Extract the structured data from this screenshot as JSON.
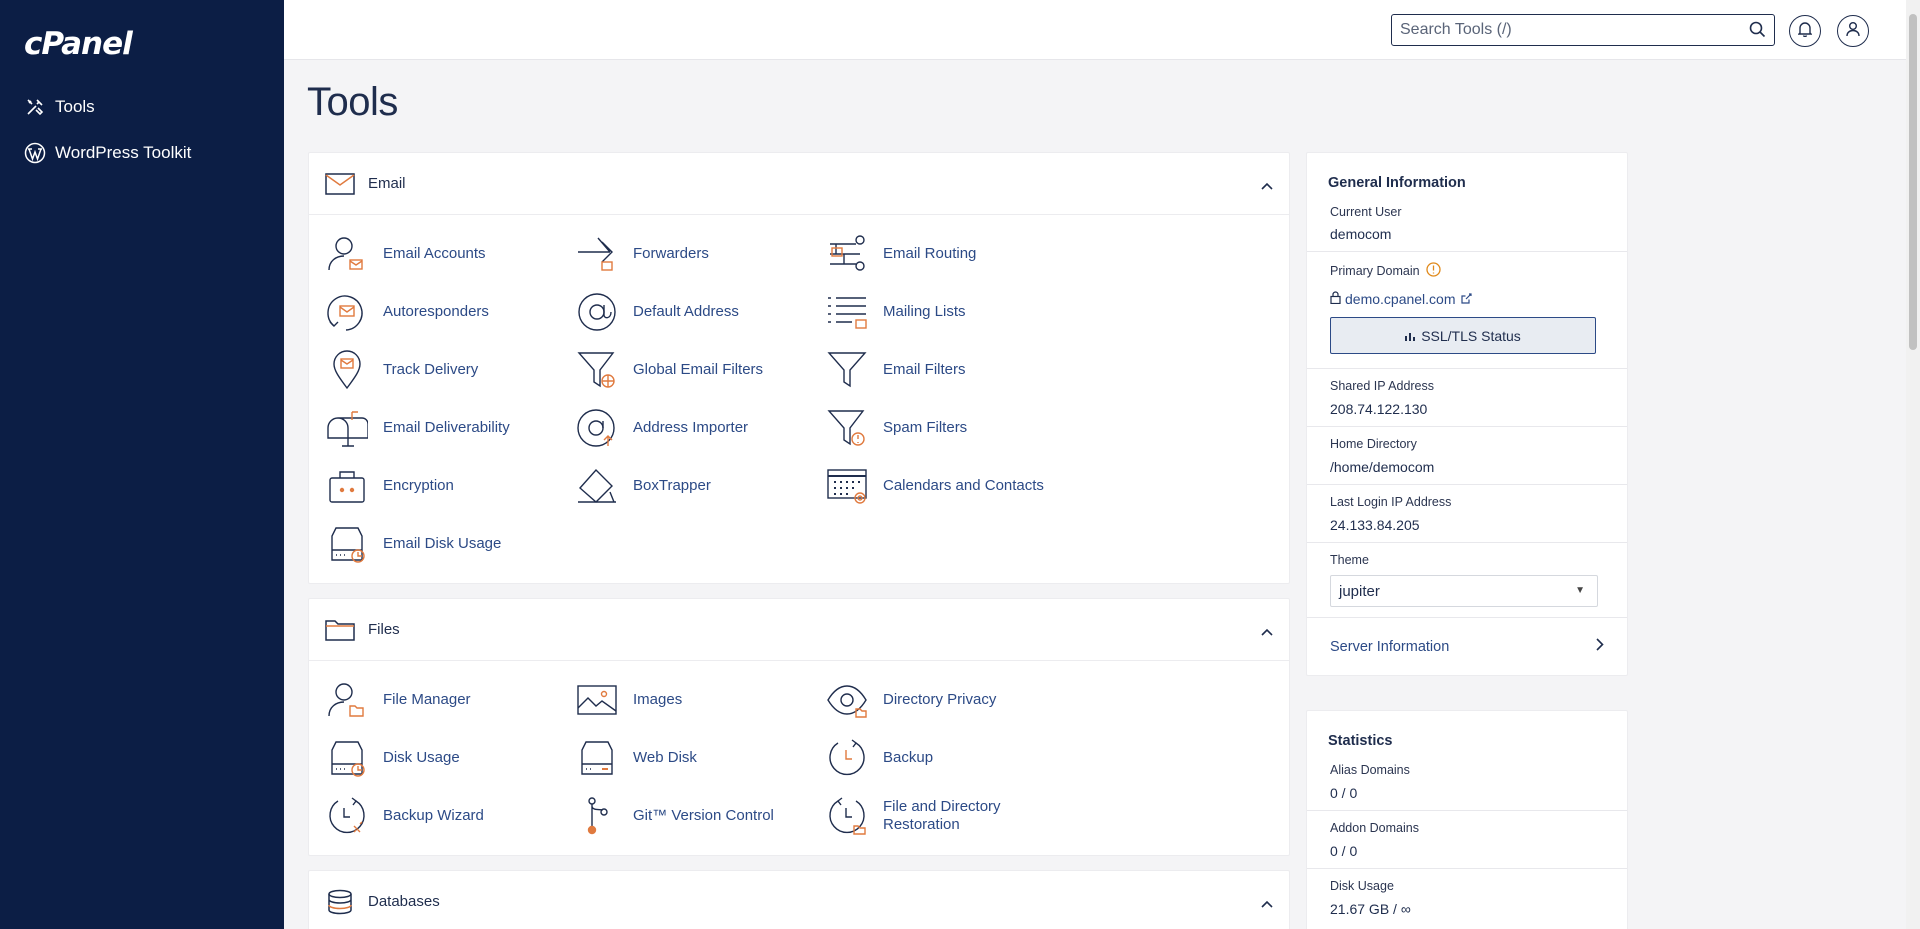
{
  "sidebar": {
    "logo": "cPanel",
    "items": [
      {
        "label": "Tools",
        "icon": "tools-icon"
      },
      {
        "label": "WordPress Toolkit",
        "icon": "wordpress-icon"
      }
    ]
  },
  "topbar": {
    "search_placeholder": "Search Tools (/)",
    "notification_icon": "bell-icon",
    "user_icon": "user-icon"
  },
  "page_title": "Tools",
  "sections": {
    "email": {
      "title": "Email",
      "tools": [
        "Email Accounts",
        "Forwarders",
        "Email Routing",
        "Autoresponders",
        "Default Address",
        "Mailing Lists",
        "Track Delivery",
        "Global Email Filters",
        "Email Filters",
        "Email Deliverability",
        "Address Importer",
        "Spam Filters",
        "Encryption",
        "BoxTrapper",
        "Calendars and Contacts",
        "Email Disk Usage"
      ]
    },
    "files": {
      "title": "Files",
      "tools": [
        "File Manager",
        "Images",
        "Directory Privacy",
        "Disk Usage",
        "Web Disk",
        "Backup",
        "Backup Wizard",
        "Git™ Version Control",
        "File and Directory Restoration"
      ]
    },
    "databases": {
      "title": "Databases"
    }
  },
  "general_info": {
    "title": "General Information",
    "current_user_label": "Current User",
    "current_user": "democom",
    "primary_domain_label": "Primary Domain",
    "primary_domain": "demo.cpanel.com",
    "ssl_button": "SSL/TLS Status",
    "shared_ip_label": "Shared IP Address",
    "shared_ip": "208.74.122.130",
    "home_dir_label": "Home Directory",
    "home_dir": "/home/democom",
    "last_login_label": "Last Login IP Address",
    "last_login": "24.133.84.205",
    "theme_label": "Theme",
    "theme": "jupiter",
    "server_info": "Server Information"
  },
  "statistics": {
    "title": "Statistics",
    "alias_label": "Alias Domains",
    "alias": "0 / 0",
    "addon_label": "Addon Domains",
    "addon": "0 / 0",
    "disk_label": "Disk Usage",
    "disk": "21.67 GB / ∞"
  },
  "colors": {
    "sidebar": "#0c1e45",
    "accent": "#e07a3f",
    "link": "#2c4a86"
  }
}
